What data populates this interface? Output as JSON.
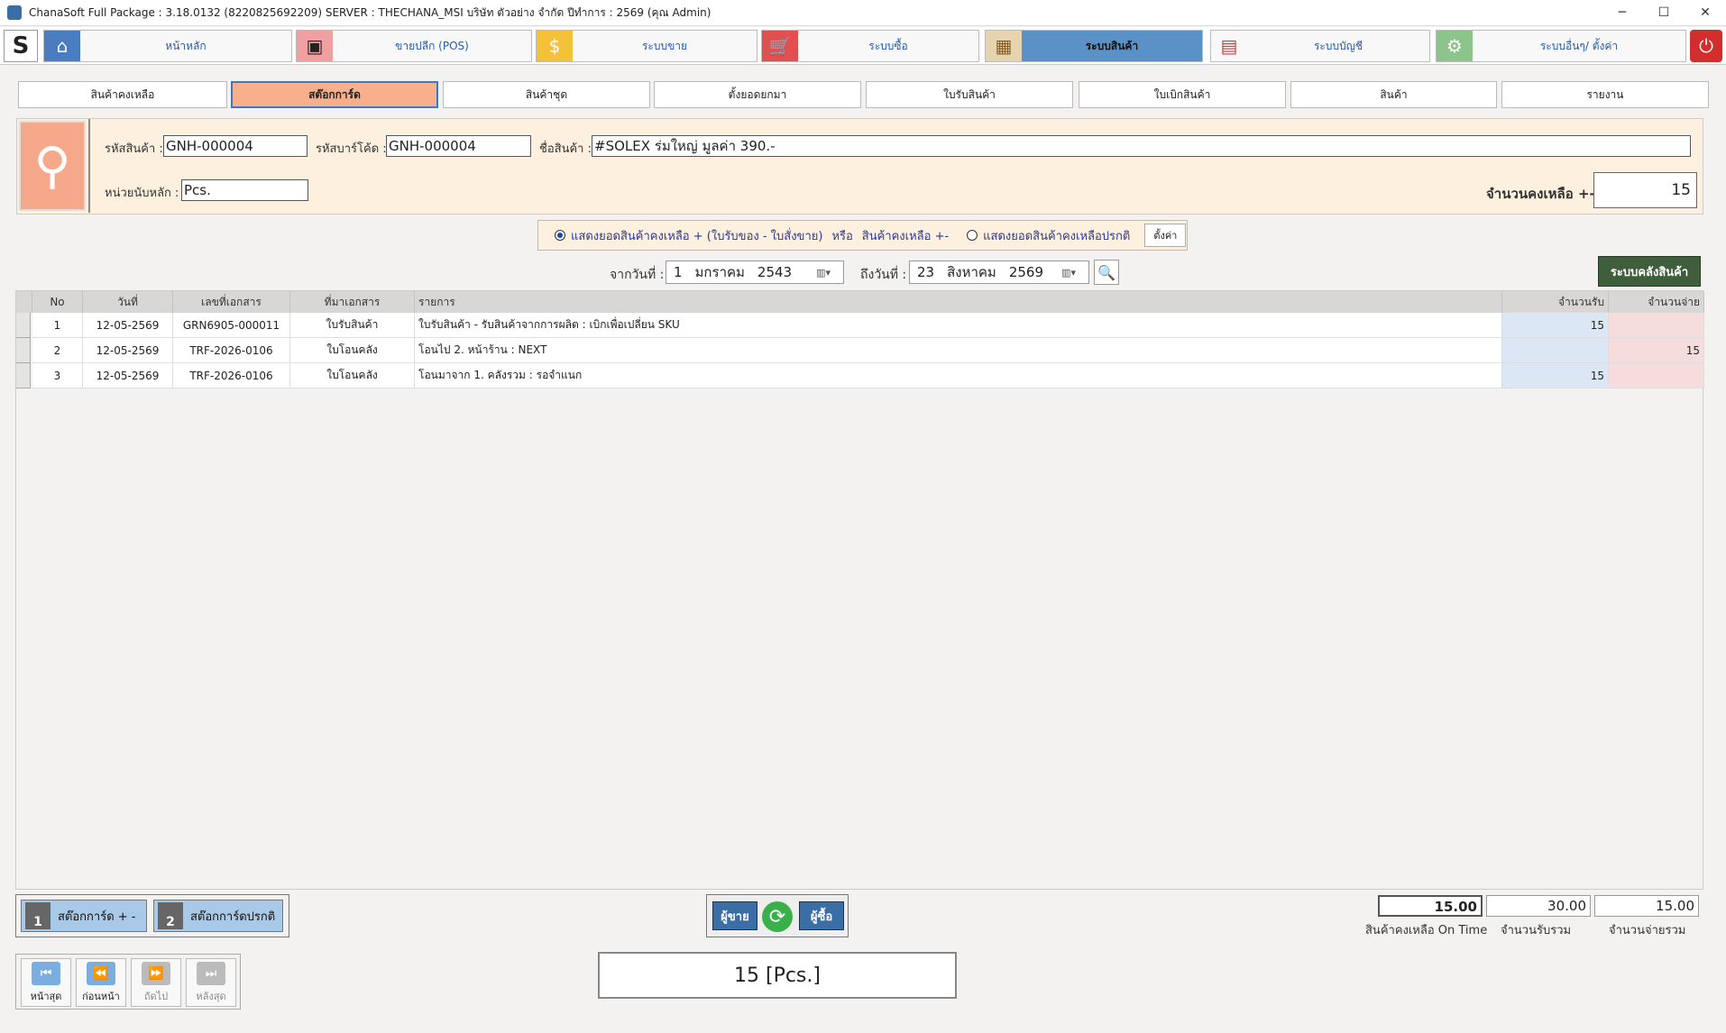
{
  "window": {
    "title": "ChanaSoft Full Package : 3.18.0132 (8220825692209) SERVER : THECHANA_MSI บริษัท ตัวอย่าง จำกัด ปีทำการ : 2569 (คุณ Admin)",
    "minimize": "─",
    "maximize": "☐",
    "close": "✕"
  },
  "nav": {
    "home": "หน้าหลัก",
    "pos": "ขายปลีก (POS)",
    "sales": "ระบบขาย",
    "purchase": "ระบบซื้อ",
    "inventory": "ระบบสินค้า",
    "accounting": "ระบบบัญชี",
    "settings": "ระบบอื่นๆ/ ตั้งค่า"
  },
  "tabs": [
    "สินค้าคงเหลือ",
    "สต๊อกการ์ด",
    "สินค้าชุด",
    "ตั้งยอดยกมา",
    "ใบรับสินค้า",
    "ใบเบิกสินค้า",
    "สินค้า",
    "รายงาน"
  ],
  "product": {
    "code_label": "รหัสสินค้า :",
    "code": "GNH-000004",
    "barcode_label": "รหัสบาร์โค้ด :",
    "barcode": "GNH-000004",
    "name_label": "ชื่อสินค้า :",
    "name": "#SOLEX ร่มใหญ่ มูลค่า 390.-",
    "unit_label": "หน่วยนับหลัก :",
    "unit": "Pcs.",
    "balance_label": "จำนวนคงเหลือ +-",
    "balance": "15"
  },
  "options": {
    "opt1": "แสดงยอดสินค้าคงเหลือ + (ใบรับของ - ใบสั่งขาย)",
    "or": "หรือ",
    "opt1b": "สินค้าคงเหลือ +-",
    "opt2": "แสดงยอดสินค้าคงเหลือปรกติ",
    "setting_btn": "ตั้งค่า"
  },
  "dates": {
    "from_label": "จากวันที่ :",
    "from_d": "1",
    "from_m": "มกราคม",
    "from_y": "2543",
    "to_label": "ถึงวันที่ :",
    "to_d": "23",
    "to_m": "สิงหาคม",
    "to_y": "2569"
  },
  "warehouse_btn": "ระบบคลังสินค้า",
  "table": {
    "headers": [
      "No",
      "วันที่",
      "เลขที่เอกสาร",
      "ที่มาเอกสาร",
      "รายการ",
      "จำนวนรับ",
      "จำนวนจ่าย"
    ],
    "rows": [
      {
        "no": "1",
        "date": "12-05-2569",
        "doc": "GRN6905-000011",
        "src": "ใบรับสินค้า",
        "desc": "ใบรับสินค้า - รับสินค้าจากการผลิต : เบิกเพื่อเปลี่ยน SKU",
        "in": "15",
        "out": ""
      },
      {
        "no": "2",
        "date": "12-05-2569",
        "doc": "TRF-2026-0106",
        "src": "ใบโอนคลัง",
        "desc": "โอนไป 2. หน้าร้าน : NEXT",
        "in": "",
        "out": "15"
      },
      {
        "no": "3",
        "date": "12-05-2569",
        "doc": "TRF-2026-0106",
        "src": "ใบโอนคลัง",
        "desc": "โอนมาจาก 1. คลังรวม : รอจำแนก",
        "in": "15",
        "out": ""
      }
    ]
  },
  "print": {
    "btn1": "สต๊อกการ์ด + -",
    "btn2": "สต๊อกการ์ดปรกติ",
    "num1": "1",
    "num2": "2"
  },
  "mid": {
    "seller": "ผู้ขาย",
    "buyer": "ผู้ซื้อ"
  },
  "summary": {
    "ontime": "15.00",
    "ontime_label": "สินค้าคงเหลือ On Time",
    "in_total": "30.00",
    "in_label": "จำนวนรับรวม",
    "out_total": "15.00",
    "out_label": "จำนวนจ่ายรวม"
  },
  "pager": {
    "first": "หน้าสุด",
    "prev": "ก่อนหน้า",
    "next": "ถัดไป",
    "last": "หลังสุด"
  },
  "unit_total": "15 [Pcs.]"
}
